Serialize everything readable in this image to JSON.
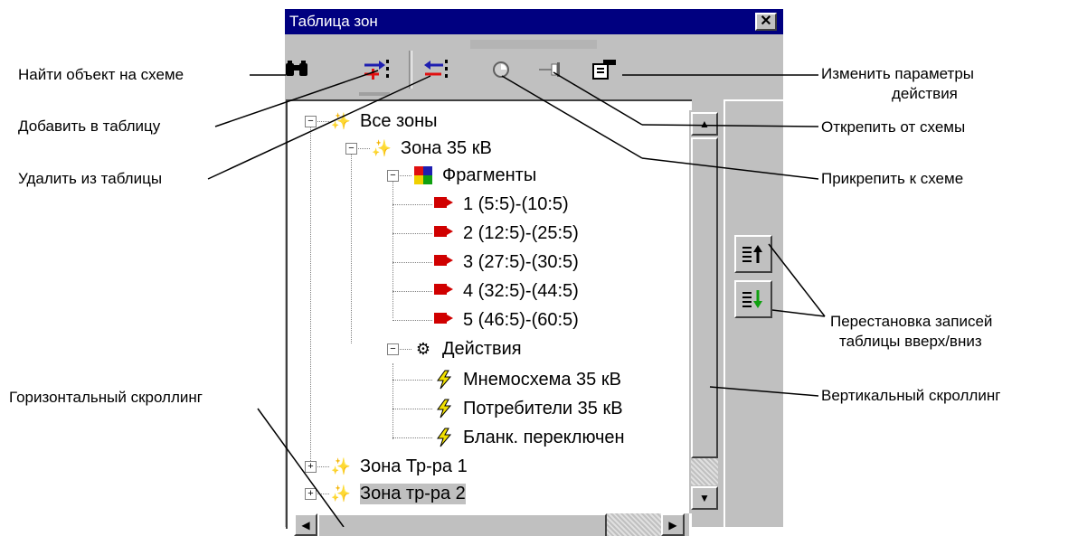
{
  "window": {
    "title": "Таблица зон",
    "close_glyph": "✕"
  },
  "toolbar": {
    "find": {
      "icon": "binoculars-icon",
      "glyph": "👀"
    },
    "add": {
      "icon": "add-to-table-icon",
      "glyph": "⇢"
    },
    "delete": {
      "icon": "delete-from-table-icon",
      "glyph": "⇠"
    },
    "attach": {
      "icon": "attach-icon",
      "glyph": "◔"
    },
    "detach": {
      "icon": "detach-icon",
      "glyph": "⊣"
    },
    "params": {
      "icon": "params-icon",
      "glyph": "⚙"
    }
  },
  "tree": {
    "root": "Все зоны",
    "zone35": "Зона 35 кВ",
    "fragments": "Фрагменты",
    "fragment_items": [
      "1 (5:5)-(10:5)",
      "2 (12:5)-(25:5)",
      "3 (27:5)-(30:5)",
      "4 (32:5)-(44:5)",
      "5 (46:5)-(60:5)"
    ],
    "actions": "Действия",
    "action_items": [
      "Мнемосхема 35 кВ",
      "Потребители 35 кВ",
      "Бланк. переключен"
    ],
    "zone_tr1": "Зона Тр-ра 1",
    "zone_tr2": "Зона тр-ра 2"
  },
  "scroll": {
    "up": "▲",
    "down": "▼",
    "left": "◀",
    "right": "▶"
  },
  "annotations": {
    "find": "Найти объект на схеме",
    "add": "Добавить в таблицу",
    "delete": "Удалить из таблицы",
    "params_line1": "Изменить параметры",
    "params_line2": "действия",
    "detach": "Открепить от схемы",
    "attach": "Прикрепить к схеме",
    "reorder_line1": "Перестановка записей",
    "reorder_line2": "таблицы вверх/вниз",
    "vscroll": "Вертикальный скроллинг",
    "hscroll": "Горизонтальный скроллинг"
  }
}
